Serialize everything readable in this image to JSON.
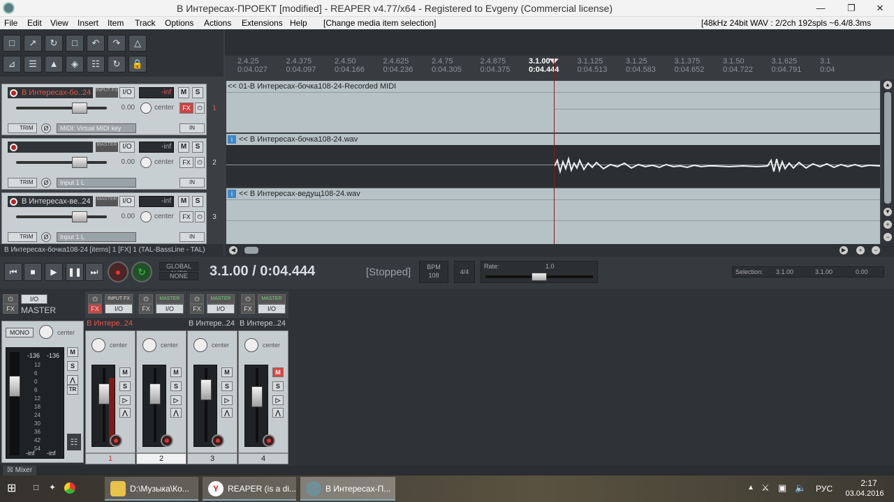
{
  "window": {
    "title": "В Интересах-ПРОЕКТ [modified] - REAPER v4.77/x64 - Registered to Evgeny (Commercial license)"
  },
  "menu": {
    "items": [
      "File",
      "Edit",
      "View",
      "Insert",
      "Item",
      "Track",
      "Options",
      "Actions",
      "Extensions",
      "Help"
    ],
    "action_hint": "[Change media item selection]",
    "audio_info": "[48kHz 24bit WAV : 2/2ch 192spls ~6.4/8.3ms ASIO]"
  },
  "ruler": {
    "marks": [
      {
        "bar": "2.4.25",
        "time": "0:04.027"
      },
      {
        "bar": "2.4.375",
        "time": "0:04.097"
      },
      {
        "bar": "2.4.50",
        "time": "0:04.166"
      },
      {
        "bar": "2.4.625",
        "time": "0:04.236"
      },
      {
        "bar": "2.4.75",
        "time": "0:04.305"
      },
      {
        "bar": "2.4.875",
        "time": "0:04.375"
      },
      {
        "bar": "3.1.00",
        "time": "0:04.444"
      },
      {
        "bar": "3.1.125",
        "time": "0:04.513"
      },
      {
        "bar": "3.1.25",
        "time": "0:04.583"
      },
      {
        "bar": "3.1.375",
        "time": "0:04.652"
      },
      {
        "bar": "3.1.50",
        "time": "0:04.722"
      },
      {
        "bar": "3.1.625",
        "time": "0:04.791"
      },
      {
        "bar": "3.1",
        "time": "0:04"
      }
    ]
  },
  "tracks": [
    {
      "num": "1",
      "name": "В Интересах-бо..24",
      "vol": "0.00",
      "pan": "center",
      "meter": "-inf",
      "input": "MIDI: Virtual MIDI key",
      "chip": "INPUT FX",
      "trim": "TRIM",
      "in": "IN",
      "io": "I/O",
      "m": "M",
      "s": "S",
      "fx": "FX"
    },
    {
      "num": "2",
      "name": "",
      "vol": "0.00",
      "pan": "center",
      "meter": "-inf",
      "input": "Input 1 L",
      "chip": "MASTER",
      "trim": "TRIM",
      "in": "IN",
      "io": "I/O",
      "m": "M",
      "s": "S",
      "fx": "FX"
    },
    {
      "num": "3",
      "name": "В Интересах-ве..24",
      "vol": "0.00",
      "pan": "center",
      "meter": "-inf",
      "input": "Input 1 L",
      "chip": "MASTER",
      "trim": "TRIM",
      "in": "IN",
      "io": "I/O",
      "m": "M",
      "s": "S",
      "fx": "FX"
    }
  ],
  "items": [
    {
      "label": "<< 01-В Интересах-бочка108-24-Recorded MIDI"
    },
    {
      "label": "<< В Интересах-бочка108-24.wav"
    },
    {
      "label": "<< В Интересах-ведущ108-24.wav"
    }
  ],
  "status": {
    "text": "В Интересах-бочка108-24 [items] 1 [FX] 1 (TAL-BassLine - TAL)"
  },
  "transport": {
    "time": "3.1.00 / 0:04.444",
    "state": "[Stopped]",
    "global_auto": "GLOBAL AUTO",
    "none": "NONE",
    "bpm_label": "BPM",
    "bpm": "108",
    "timesig": "4/4",
    "rate_label": "Rate:",
    "rate": "1.0",
    "selection_label": "Selection:",
    "sel_start": "3.1.00",
    "sel_end": "3.1.00",
    "sel_len": "0.00"
  },
  "mixer": {
    "master": {
      "label": "MASTER",
      "io": "I/O",
      "mono": "MONO",
      "pan": "center",
      "peak_l": "-136",
      "peak_r": "-136",
      "scale": [
        "12",
        "6",
        "0",
        "6",
        "12",
        "18",
        "24",
        "30",
        "36",
        "42",
        "54"
      ],
      "inf_l": "-inf",
      "inf_r": "-inf",
      "m": "M",
      "s": "S",
      "tr": "TR",
      "fx": "FX"
    },
    "strips": [
      {
        "name": "В Интере..24",
        "num": "1",
        "pan": "center",
        "m": "M",
        "s": "S",
        "io": "I/O",
        "fx": "FX",
        "chip": "INPUT FX"
      },
      {
        "name": "",
        "num": "2",
        "pan": "center",
        "m": "M",
        "s": "S",
        "io": "I/O",
        "fx": "FX",
        "chip": "MASTER"
      },
      {
        "name": "В Интере..24",
        "num": "3",
        "pan": "center",
        "m": "M",
        "s": "S",
        "io": "I/O",
        "fx": "FX",
        "chip": "MASTER"
      },
      {
        "name": "В Интере..24",
        "num": "4",
        "pan": "center",
        "m": "M",
        "s": "S",
        "io": "I/O",
        "fx": "FX",
        "chip": "MASTER"
      }
    ],
    "tab": "Mixer"
  },
  "taskbar": {
    "tasks": [
      {
        "label": "D:\\Музыка\\Ко..."
      },
      {
        "label": "REAPER (is a di..."
      },
      {
        "label": "В Интересах-П..."
      }
    ],
    "lang": "РУС",
    "time": "2:17",
    "date": "03.04.2016"
  }
}
